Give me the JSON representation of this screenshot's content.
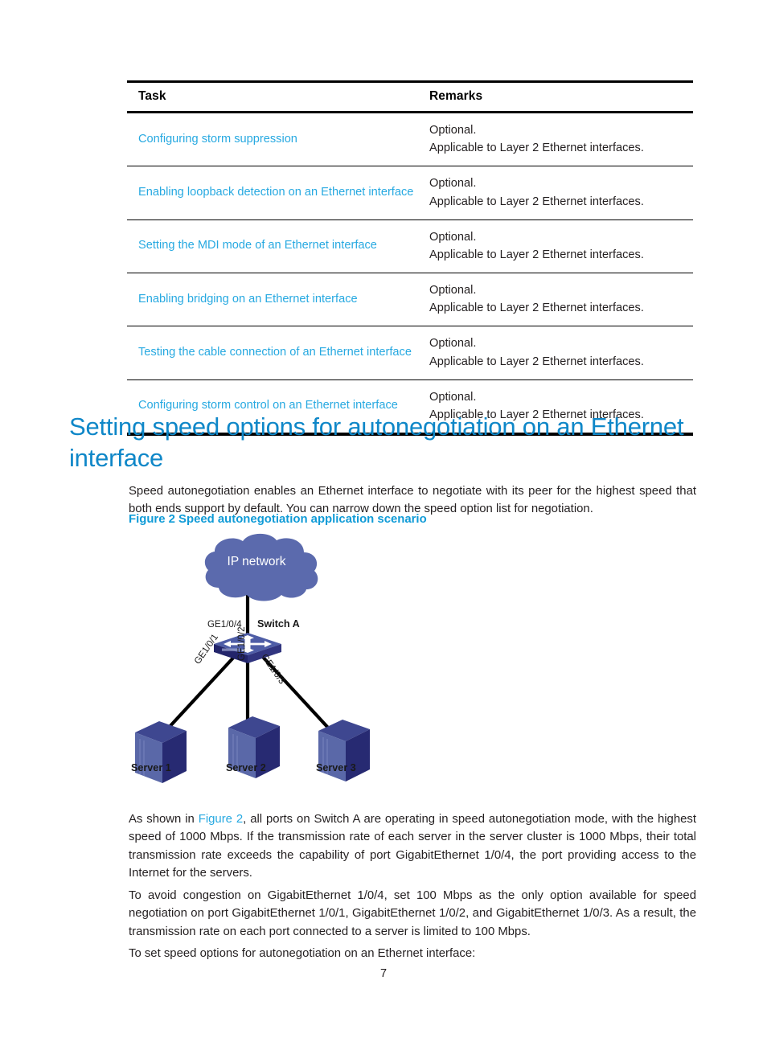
{
  "table": {
    "headers": {
      "task": "Task",
      "remarks": "Remarks"
    },
    "rows": [
      {
        "task": "Configuring storm suppression",
        "remark1": "Optional.",
        "remark2": "Applicable to Layer 2 Ethernet interfaces."
      },
      {
        "task": "Enabling loopback detection on an Ethernet interface",
        "remark1": "Optional.",
        "remark2": "Applicable to Layer 2 Ethernet interfaces."
      },
      {
        "task": "Setting the MDI mode of an Ethernet interface",
        "remark1": "Optional.",
        "remark2": "Applicable to Layer 2 Ethernet interfaces."
      },
      {
        "task": "Enabling bridging on an Ethernet interface",
        "remark1": "Optional.",
        "remark2": "Applicable to Layer 2 Ethernet interfaces."
      },
      {
        "task": "Testing the cable connection of an Ethernet interface",
        "remark1": "Optional.",
        "remark2": "Applicable to Layer 2 Ethernet interfaces."
      },
      {
        "task": "Configuring storm control on an Ethernet interface",
        "remark1": "Optional.",
        "remark2": "Applicable to Layer 2 Ethernet interfaces."
      }
    ]
  },
  "section": {
    "heading": "Setting speed options for autonegotiation on an Ethernet interface",
    "intro": "Speed autonegotiation enables an Ethernet interface to negotiate with its peer for the highest speed that both ends support by default. You can narrow down the speed option list for negotiation.",
    "figure_caption": "Figure 2 Speed autonegotiation application scenario"
  },
  "paragraphs": {
    "as_shown_prefix": "As shown in ",
    "as_shown_link": "Figure 2",
    "as_shown_rest": ", all ports on Switch A are operating in speed autonegotiation mode, with the highest speed of 1000 Mbps. If the transmission rate of each server in the server cluster is 1000 Mbps, their total transmission rate exceeds the capability of port GigabitEthernet 1/0/4, the port providing access to the Internet for the servers.",
    "avoid_congestion": "To avoid congestion on GigabitEthernet 1/0/4, set 100 Mbps as the only option available for speed negotiation on port GigabitEthernet 1/0/1, GigabitEthernet 1/0/2, and GigabitEthernet 1/0/3. As a result, the transmission rate on each port connected to a server is limited to 100 Mbps.",
    "to_set": "To set speed options for autonegotiation on an Ethernet interface:"
  },
  "diagram": {
    "cloud_label": "IP network",
    "switch_label": "Switch A",
    "uplink_port": "GE1/0/4",
    "port_1": "GE1/0/1",
    "port_2": "GE1/0/2",
    "port_3": "GE1/0/3",
    "server_1": "Server 1",
    "server_2": "Server 2",
    "server_3": "Server 3"
  },
  "footer": {
    "page_number": "7"
  },
  "colors": {
    "link_blue": "#27a9e1",
    "heading_blue": "#0f87c8",
    "caption_blue": "#0f9bd7",
    "cloud_fill": "#5b6aad",
    "device_dark": "#272a72",
    "device_mid": "#5a68a8",
    "line_black": "#000000"
  }
}
